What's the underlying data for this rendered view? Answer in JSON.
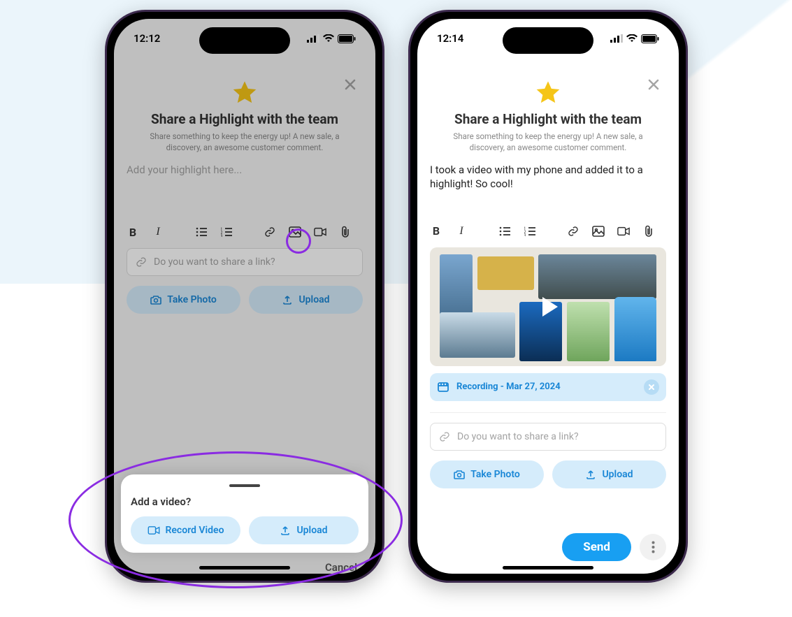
{
  "status_bar": {
    "time_left": "12:12",
    "time_right": "12:14"
  },
  "header": {
    "title": "Share a Highlight with the team",
    "subtitle": "Share something to keep the energy up! A new sale, a discovery, an awesome customer comment."
  },
  "left": {
    "input_placeholder": "Add your highlight here...",
    "link_placeholder": "Do you want to share a link?",
    "take_photo": "Take Photo",
    "upload": "Upload",
    "sheet_title": "Add a video?",
    "record_video": "Record Video",
    "cancel": "Cancel"
  },
  "right": {
    "body_text": "I took a video with my phone and added it to a highlight! So cool!",
    "attachment_label": "Recording - Mar 27, 2024",
    "link_placeholder": "Do you want to share a link?",
    "take_photo": "Take Photo",
    "upload": "Upload",
    "send": "Send"
  },
  "toolbar_items": [
    "bold",
    "italic",
    "bullet-list",
    "numbered-list",
    "link",
    "image",
    "video",
    "attachment"
  ],
  "colors": {
    "accent": "#189ff2",
    "accent_light": "#d5ecfb",
    "highlight_ring": "#8a2be2",
    "star": "#f5c518"
  }
}
